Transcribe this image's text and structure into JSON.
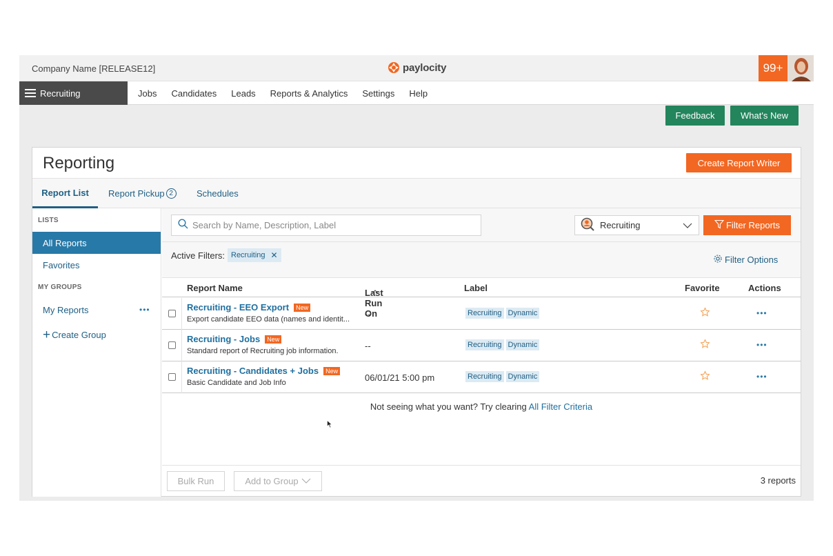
{
  "topbar": {
    "company": "Company Name [RELEASE12]",
    "logo_text": "paylocity",
    "notifications": "99+",
    "colors": {
      "brand_orange": "#f26722",
      "brand_green": "#23855c",
      "link_blue": "#1f6fa0"
    }
  },
  "nav": {
    "module": "Recruiting",
    "links": [
      "Jobs",
      "Candidates",
      "Leads",
      "Reports & Analytics",
      "Settings",
      "Help"
    ]
  },
  "actions": {
    "feedback": "Feedback",
    "whats_new": "What's New"
  },
  "panel": {
    "title": "Reporting",
    "create_button": "Create Report Writer",
    "tabs": {
      "report_list": "Report List",
      "report_pickup": "Report Pickup",
      "report_pickup_count": "2",
      "schedules": "Schedules"
    }
  },
  "sidebar": {
    "lists_heading": "LISTS",
    "all_reports": "All Reports",
    "favorites": "Favorites",
    "groups_heading": "MY GROUPS",
    "my_reports": "My Reports",
    "create_group": "Create Group"
  },
  "search": {
    "placeholder": "Search by Name, Description, Label",
    "value": ""
  },
  "category": {
    "selected": "Recruiting"
  },
  "filter_button": "Filter Reports",
  "filters": {
    "active_label": "Active Filters:",
    "chip": "Recruiting",
    "options": "Filter Options"
  },
  "table": {
    "columns": {
      "name": "Report Name",
      "last_run": "Last Run On",
      "label": "Label",
      "favorite": "Favorite",
      "actions": "Actions"
    },
    "rows": [
      {
        "name": "Recruiting - EEO Export",
        "badge": "New",
        "description": "Export candidate EEO data (names and identit...",
        "last_run": "--",
        "tags": [
          "Recruiting",
          "Dynamic"
        ]
      },
      {
        "name": "Recruiting - Jobs",
        "badge": "New",
        "description": "Standard report of Recruiting job information.",
        "last_run": "--",
        "tags": [
          "Recruiting",
          "Dynamic"
        ]
      },
      {
        "name": "Recruiting - Candidates + Jobs",
        "badge": "New",
        "description": "Basic Candidate and Job Info",
        "last_run": "06/01/21 5:00 pm",
        "tags": [
          "Recruiting",
          "Dynamic"
        ]
      }
    ]
  },
  "empty_hint": {
    "text": "Not seeing what you want? Try clearing ",
    "link": "All Filter Criteria"
  },
  "footer": {
    "bulk_run": "Bulk Run",
    "add_to_group": "Add to Group",
    "count": "3 reports"
  }
}
